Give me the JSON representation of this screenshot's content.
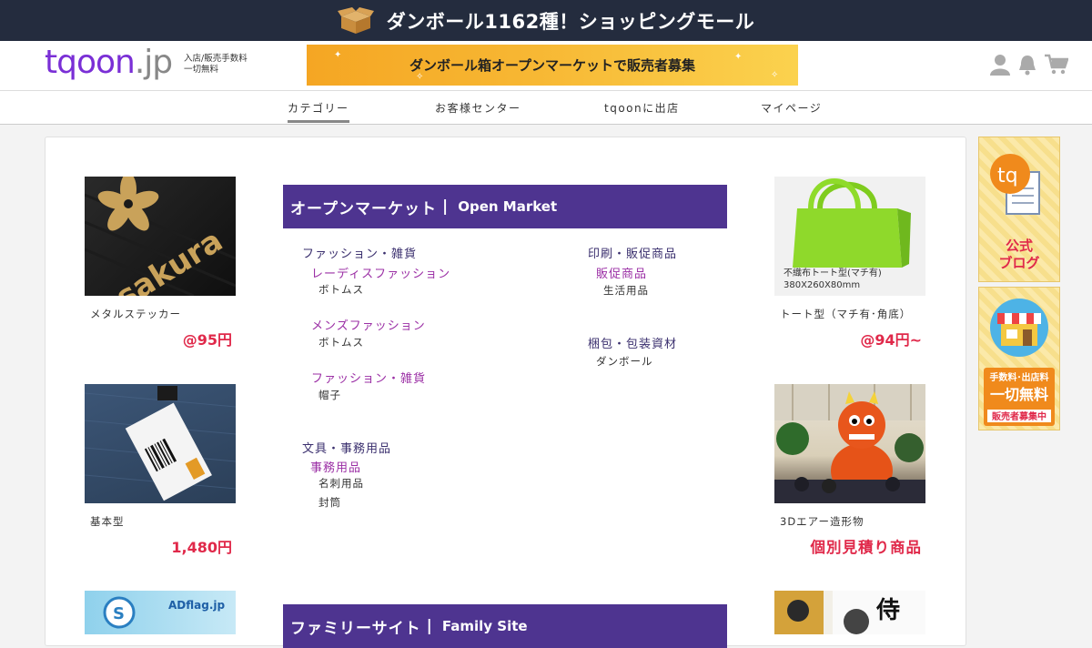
{
  "topbar": {
    "title": "ダンボール1162種！ショッピングモール"
  },
  "header": {
    "logo_main": "tqoon",
    "logo_suffix": ".jp",
    "logo_sub1": "入店/販売手数料",
    "logo_sub2": "一切無料",
    "banner_text": "ダンボール箱オープンマーケットで販売者募集"
  },
  "nav": {
    "items": [
      "カテゴリー",
      "お客様センター",
      "tqoonに出店",
      "マイページ"
    ]
  },
  "left_products": [
    {
      "name": "メタルステッカー",
      "price": "@95円",
      "image_text": "sakura"
    },
    {
      "name": "基本型",
      "price": "1,480円"
    },
    {
      "image_text": "ADflag.jp"
    }
  ],
  "right_products": [
    {
      "name": "トート型（マチ有･角底）",
      "price": "@94円~",
      "overlay1": "不織布トート型(マチ有)",
      "overlay2": "380X260X80mm"
    },
    {
      "name": "3Dエアー造形物",
      "price": "個別見積り商品"
    },
    {
      "image_text": "侍"
    }
  ],
  "open_market": {
    "title_ja": "オープンマーケット",
    "title_sep": "|",
    "title_en": "Open Market",
    "col1": {
      "fashion": "ファッション・雑貨",
      "ladies": "レーディスファッション",
      "ladies_bottoms": "ボトムス",
      "mens": "メンズファッション",
      "mens_bottoms": "ボトムス",
      "fashion_goods": "ファッション・雑貨",
      "hat": "帽子",
      "stationery": "文具・事務用品",
      "office": "事務用品",
      "cardcase": "名刺用品",
      "envelope": "封筒"
    },
    "col2": {
      "print": "印刷・販促商品",
      "promo": "販促商品",
      "daily": "生活用品",
      "packing": "梱包・包装資材",
      "cardboard": "ダンボール"
    }
  },
  "family_site": {
    "title_ja": "ファミリーサイト",
    "title_sep": "|",
    "title_en": "Family Site"
  },
  "side_banners": {
    "blog_logo": "tq",
    "blog_line1": "公式",
    "blog_line2": "ブログ",
    "free_line1": "手数料･出店料",
    "free_line2": "一切無料",
    "free_line3": "販売者募集中"
  },
  "colors": {
    "accent_purple": "#4e3490",
    "price_red": "#e0294a",
    "logo_purple": "#7a2fd6"
  }
}
